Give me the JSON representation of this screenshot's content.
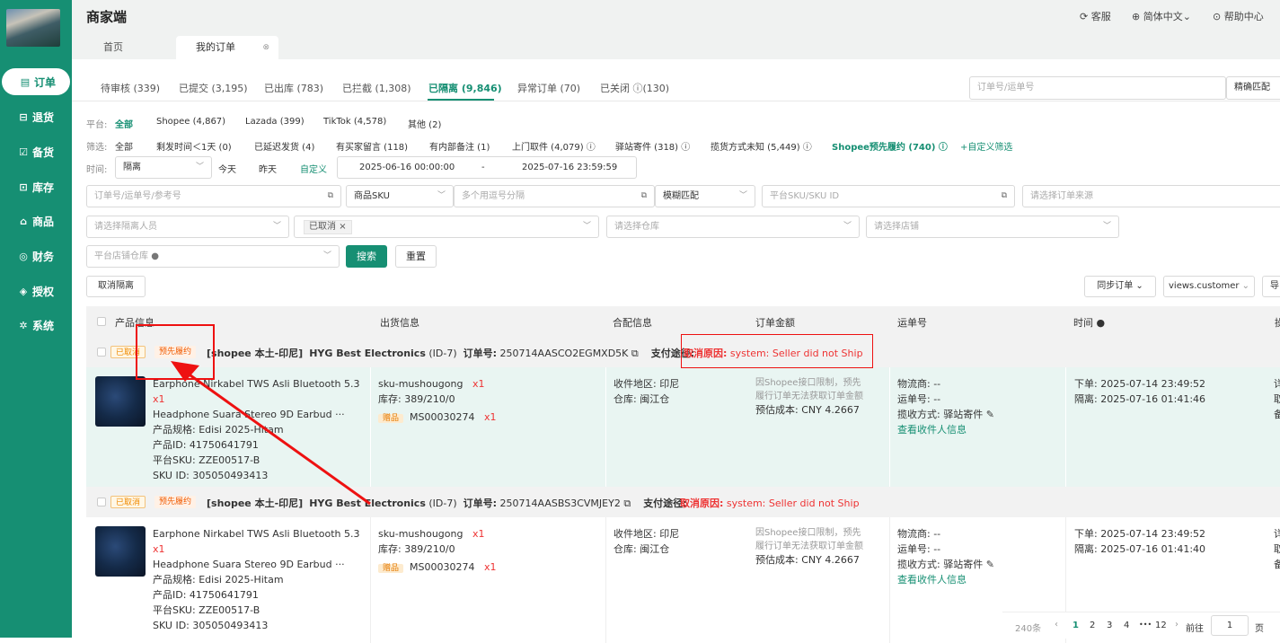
{
  "app": {
    "title": "商家端",
    "header_links": [
      "客服",
      "简体中文",
      "帮助中心"
    ]
  },
  "sidebar": {
    "items": [
      {
        "label": "订单",
        "icon": "order-icon"
      },
      {
        "label": "退货",
        "icon": "return-icon"
      },
      {
        "label": "备货",
        "icon": "stock-icon"
      },
      {
        "label": "库存",
        "icon": "inventory-icon"
      },
      {
        "label": "商品",
        "icon": "product-icon"
      },
      {
        "label": "财务",
        "icon": "finance-icon"
      },
      {
        "label": "授权",
        "icon": "auth-icon"
      },
      {
        "label": "系统",
        "icon": "system-icon"
      }
    ]
  },
  "page_tabs": [
    {
      "label": "首页"
    },
    {
      "label": "我的订单"
    }
  ],
  "status_tabs": [
    {
      "label": "待审核 (339)"
    },
    {
      "label": "已提交 (3,195)"
    },
    {
      "label": "已出库 (783)"
    },
    {
      "label": "已拦截 (1,308)"
    },
    {
      "label": "已隔离 (9,846)"
    },
    {
      "label": "异常订单 (70)"
    },
    {
      "label": "已关闭",
      "count": "(130)"
    }
  ],
  "top_search": {
    "placeholder": "订单号/运单号",
    "mode": "精确匹配"
  },
  "filters": {
    "platform_label": "平台:",
    "platforms": [
      "全部",
      "Shopee (4,867)",
      "Lazada (399)",
      "TikTok (4,578)",
      "其他 (2)"
    ],
    "screen_label": "筛选:",
    "screens": [
      "全部",
      "剩发时间＜1天 (0)",
      "已延迟发货 (4)",
      "有买家留言 (118)",
      "有内部备注 (1)",
      "上门取件 (4,079)",
      "驿站寄件 (318)",
      "揽货方式未知 (5,449)",
      "Shopee预先履约 (740)",
      "+自定义筛选"
    ],
    "time_label": "时间:",
    "time_type": "隔离",
    "time_quick": [
      "今天",
      "昨天",
      "自定义"
    ],
    "time_start": "2025-06-16 00:00:00",
    "time_sep": "-",
    "time_end": "2025-07-16 23:59:59"
  },
  "search": {
    "order_placeholder": "订单号/运单号/参考号",
    "sku_type": "商品SKU",
    "sku_placeholder": "多个用逗号分隔",
    "match_type": "模糊匹配",
    "platform_sku_placeholder": "平台SKU/SKU ID",
    "source_placeholder": "请选择订单来源",
    "isolator_placeholder": "请选择隔离人员",
    "status_tag": "已取消",
    "warehouse_placeholder": "请选择仓库",
    "store_placeholder": "请选择店铺",
    "platform_wh_placeholder": "平台店铺仓库",
    "search_btn": "搜索",
    "reset_btn": "重置"
  },
  "toolbar": {
    "cancel_isolation": "取消隔离",
    "sync_order": "同步订单",
    "view": "views.customer",
    "export": "导"
  },
  "table": {
    "columns": [
      "产品信息",
      "出货信息",
      "合配信息",
      "订单金额",
      "运单号",
      "时间",
      "操"
    ]
  },
  "orders": [
    {
      "badge_cancel": "已取消",
      "badge_pre": "预先履约",
      "shop": "[shopee 本土-印尼]",
      "store": "HYG Best Electronics",
      "store_id": "(ID-7)",
      "order_no_label": "订单号:",
      "order_no": "250714AASCO2EGMXD5K",
      "pay_label": "支付途径:",
      "cancel_label": "取消原因:",
      "cancel_reason": "system: Seller did not Ship",
      "product_name1": "Earphone Nirkabel TWS Asli Bluetooth 5.3",
      "product_name2": "Headphone Suara Stereo 9D Earbud ···",
      "qty": "x1",
      "spec": "产品规格:  Edisi 2025-Hitam",
      "pid": "产品ID:  41750641791",
      "psku": "平台SKU:  ZZE00517-B",
      "skuid": "SKU ID:  305050493413",
      "ship_sku": "sku-mushougong",
      "ship_qty": "x1",
      "stock": "库存:  389/210/0",
      "gift_tag": "赠品",
      "gift_sku": "MS00030274",
      "gift_qty": "x1",
      "region": "收件地区:  印尼",
      "warehouse": "仓库:  闽江仓",
      "amount_note1": "因Shopee接口限制，预先",
      "amount_note2": "履行订单无法获取订单金额",
      "cost": "预估成本:  CNY 4.2667",
      "carrier": "物流商:  --",
      "waybill": "运单号:  --",
      "pickup": "揽收方式:  驿站寄件",
      "view_recipient": "查看收件人信息",
      "order_time": "下单:  2025-07-14 23:49:52",
      "iso_time": "隔离:  2025-07-16 01:41:46",
      "ops": [
        "详",
        "取",
        "备"
      ]
    },
    {
      "badge_cancel": "已取消",
      "badge_pre": "预先履约",
      "shop": "[shopee 本土-印尼]",
      "store": "HYG Best Electronics",
      "store_id": "(ID-7)",
      "order_no_label": "订单号:",
      "order_no": "250714AASBS3CVMJEY2",
      "pay_label": "支付途径:",
      "cancel_label": "取消原因:",
      "cancel_reason": "system: Seller did not Ship",
      "product_name1": "Earphone Nirkabel TWS Asli Bluetooth 5.3",
      "product_name2": "Headphone Suara Stereo 9D Earbud ···",
      "qty": "x1",
      "spec": "产品规格:  Edisi 2025-Hitam",
      "pid": "产品ID:  41750641791",
      "psku": "平台SKU:  ZZE00517-B",
      "skuid": "SKU ID:  305050493413",
      "ship_sku": "sku-mushougong",
      "ship_qty": "x1",
      "stock": "库存:  389/210/0",
      "gift_tag": "赠品",
      "gift_sku": "MS00030274",
      "gift_qty": "x1",
      "region": "收件地区:  印尼",
      "warehouse": "仓库:  闽江仓",
      "amount_note1": "因Shopee接口限制，预先",
      "amount_note2": "履行订单无法获取订单金额",
      "cost": "预估成本:  CNY 4.2667",
      "carrier": "物流商:  --",
      "waybill": "运单号:  --",
      "pickup": "揽收方式:  驿站寄件",
      "view_recipient": "查看收件人信息",
      "order_time": "下单:  2025-07-14 23:49:52",
      "iso_time": "隔离:  2025-07-16 01:41:40",
      "ops": [
        "详",
        "取",
        "备"
      ]
    }
  ],
  "pagination": {
    "total": "240条",
    "pages": [
      "1",
      "2",
      "3",
      "4",
      "•••",
      "12"
    ],
    "goto_label": "前往",
    "goto_value": "1",
    "page_unit": "页"
  }
}
